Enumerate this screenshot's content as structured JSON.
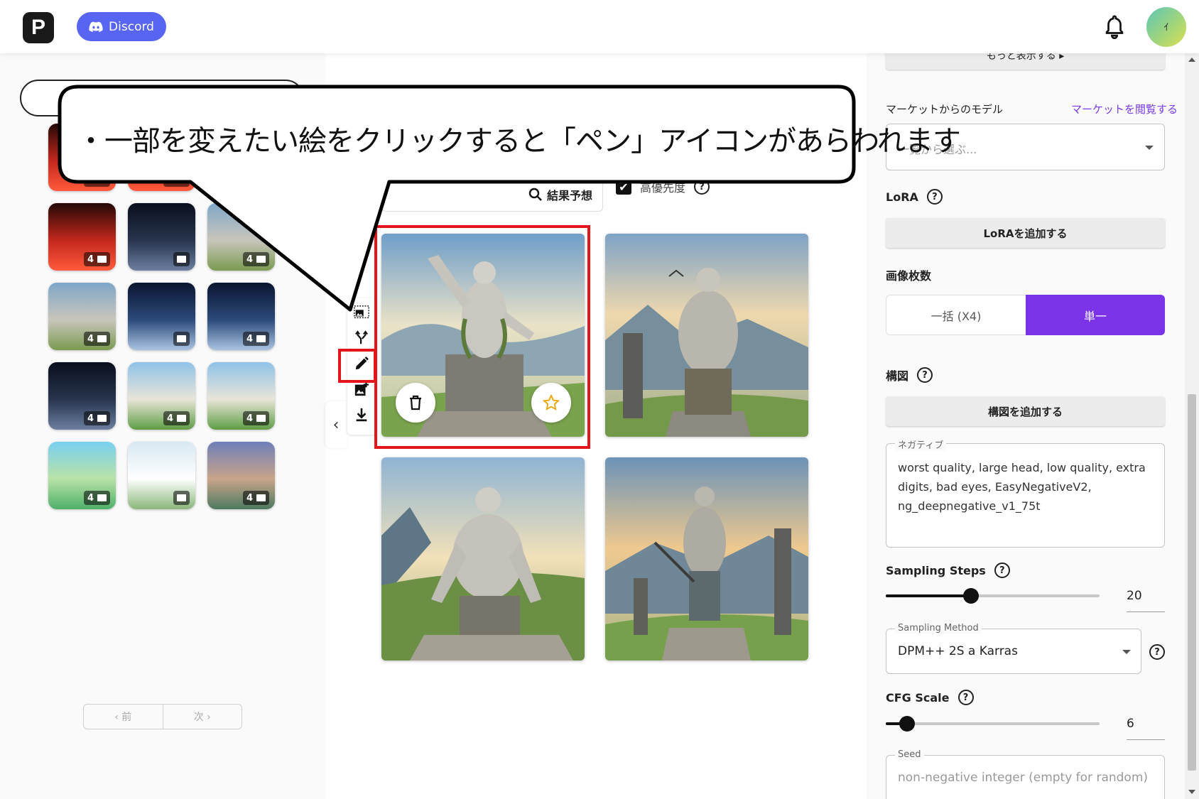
{
  "header": {
    "logo_letter": "P",
    "discord_label": "Discord",
    "avatar_initial": "ｲ"
  },
  "left": {
    "thumbnails": [
      {
        "badge": "4",
        "palette": "neon-red"
      },
      {
        "badge": "4",
        "palette": "neon-red"
      },
      {
        "badge": "4",
        "palette": "neon-red"
      },
      {
        "badge": "4",
        "palette": "neon-red"
      },
      {
        "badge": "",
        "palette": "night-tree"
      },
      {
        "badge": "4",
        "palette": "statue"
      },
      {
        "badge": "4",
        "palette": "statue"
      },
      {
        "badge": "",
        "palette": "moon-lake"
      },
      {
        "badge": "4",
        "palette": "moon-lake"
      },
      {
        "badge": "4",
        "palette": "night-tree"
      },
      {
        "badge": "4",
        "palette": "mansion"
      },
      {
        "badge": "4",
        "palette": "mansion"
      },
      {
        "badge": "4",
        "palette": "green-castle"
      },
      {
        "badge": "",
        "palette": "white-building"
      },
      {
        "badge": "4",
        "palette": "dusk-town"
      }
    ],
    "pager": {
      "prev": "‹ 前",
      "next": "次 ›"
    }
  },
  "middle": {
    "predict_label": "結果予想",
    "priority_label": "高優先度",
    "collapse_glyph": "‹"
  },
  "callout": {
    "text": "・一部を変えたい絵をクリックすると「ペン」アイコンがあらわれます"
  },
  "right": {
    "more_label": "もっと表示する ▸",
    "market_label": "マーケットからのモデル",
    "market_link": "マーケットを閲覧する",
    "market_placeholder": "一覧から選ぶ...",
    "lora_label": "LoRA",
    "lora_button": "LoRAを追加する",
    "count_label": "画像枚数",
    "count_options": [
      "一括 (X4)",
      "単一"
    ],
    "count_selected": "単一",
    "composition_label": "構図",
    "composition_button": "構図を追加する",
    "negative_legend": "ネガティブ",
    "negative_text": "worst quality, large head, low quality, extra digits, bad eyes, EasyNegativeV2, ng_deepnegative_v1_75t",
    "steps_label": "Sampling Steps",
    "steps_value": "20",
    "steps_level": 0.4,
    "method_legend": "Sampling Method",
    "method_value": "DPM++ 2S a Karras",
    "cfg_label": "CFG Scale",
    "cfg_value": "6",
    "cfg_level": 0.1,
    "seed_legend": "Seed",
    "seed_placeholder": "non-negative integer (empty for random)"
  },
  "colors": {
    "accent": "#7b33e8",
    "discord": "#5865f2",
    "highlight": "#e3141a"
  }
}
